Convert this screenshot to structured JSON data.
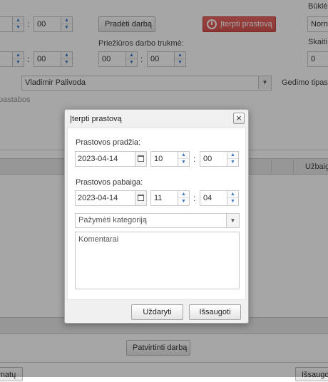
{
  "form": {
    "row1": {
      "hours": "",
      "minutes": "00",
      "separator": ":"
    },
    "row2": {
      "hours": "",
      "minutes": "00",
      "separator": ":"
    },
    "start_work_button": "Pradėti darbą",
    "insert_downtime_button": "Įterpti prastovą",
    "status_label": "Būklė",
    "status_select": "Norn",
    "maintenance_label": "Priežiūros darbo trukmė:",
    "maintenance": {
      "hours": "00",
      "minutes": "00",
      "separator": ":"
    },
    "count_label": "Skaiti",
    "count_value": "0",
    "operator_select": "Vladimir Palivoda",
    "defect_type_label": "Gedimo tipas",
    "notes_label": "pastabos",
    "column_finish": "Užbaig",
    "confirm_work_button": "Patvirtinti darbą",
    "bottom_left_button": "matų",
    "bottom_right_button": "Išsaugoti"
  },
  "dialog": {
    "title": "Įterpti prastovą",
    "close_symbol": "×",
    "start_label": "Prastovos pradžia:",
    "start_date": "2023-04-14",
    "start_hour": "10",
    "start_minute": "00",
    "end_label": "Prastovos pabaiga:",
    "end_date": "2023-04-14",
    "end_hour": "11",
    "end_minute": "04",
    "time_separator": ":",
    "category_placeholder": "Pažymėti kategoriją",
    "comment_placeholder": "Komentarai",
    "close_button": "Uždaryti",
    "save_button": "Išsaugoti"
  },
  "icons": {
    "up": "▲",
    "down": "▼",
    "caret": "▼"
  },
  "colors": {
    "accent_red": "#d9534f",
    "spinner_arrow": "#3a78c3",
    "overlay": "rgba(0,0,0,0.35)"
  }
}
